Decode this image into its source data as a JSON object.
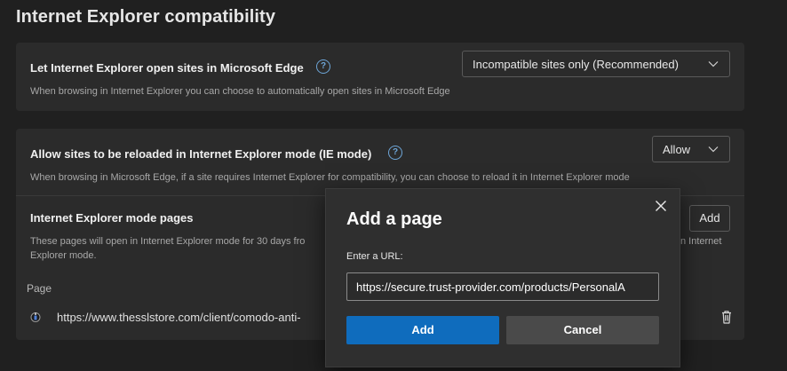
{
  "section_title": "Internet Explorer compatibility",
  "setting1": {
    "title": "Let Internet Explorer open sites in Microsoft Edge",
    "description": "When browsing in Internet Explorer you can choose to automatically open sites in Microsoft Edge",
    "dropdown_value": "Incompatible sites only (Recommended)"
  },
  "setting2": {
    "title": "Allow sites to be reloaded in Internet Explorer mode (IE mode)",
    "description": "When browsing in Microsoft Edge, if a site requires Internet Explorer for compatibility, you can choose to reload it in Internet Explorer mode",
    "dropdown_value": "Allow"
  },
  "ie_pages": {
    "title": "Internet Explorer mode pages",
    "description_line1_left": "These pages will open in Internet Explorer mode for 30 days fro",
    "description_line1_right": "n Internet",
    "description_line2": "Explorer mode.",
    "add_label": "Add",
    "column_header": "Page",
    "rows": [
      {
        "url": "https://www.thesslstore.com/client/comodo-anti-"
      }
    ]
  },
  "modal": {
    "title": "Add a page",
    "url_label": "Enter a URL:",
    "url_value": "https://secure.trust-provider.com/products/PersonalA",
    "add_label": "Add",
    "cancel_label": "Cancel"
  },
  "colors": {
    "background": "#202020",
    "card": "#2b2b2b",
    "accent": "#0f6cbd",
    "help_icon": "#6ea6d8"
  }
}
